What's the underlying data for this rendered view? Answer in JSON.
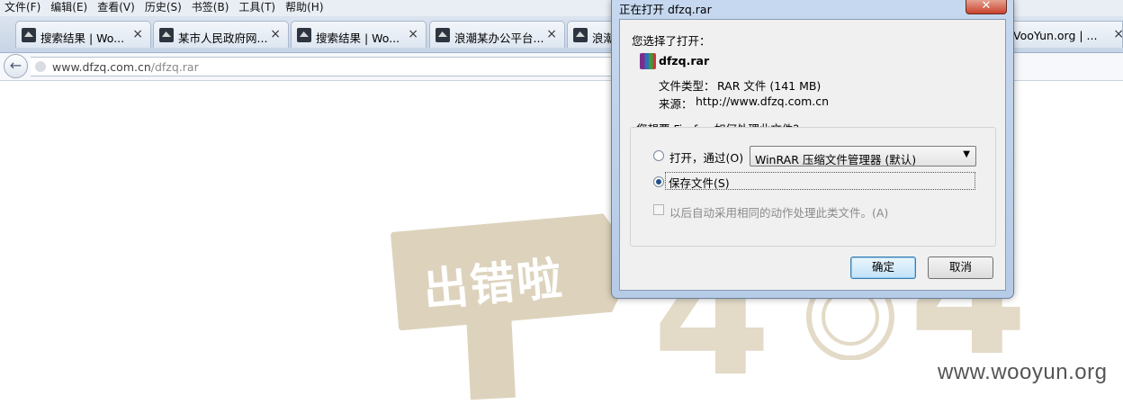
{
  "menu": [
    "文件(F)",
    "编辑(E)",
    "查看(V)",
    "历史(S)",
    "书签(B)",
    "工具(T)",
    "帮助(H)"
  ],
  "tabs": [
    {
      "label": "搜索结果 | Wo..."
    },
    {
      "label": "某市人民政府网..."
    },
    {
      "label": "搜索结果 | Wo..."
    },
    {
      "label": "浪潮某办公平台..."
    },
    {
      "label": "浪潮"
    }
  ],
  "right_tab": {
    "label": "VooYun.org | ..."
  },
  "close_glyph": "×",
  "nav": {
    "back_glyph": "←",
    "url_domain": "www.dfzq.com.cn",
    "url_path": "/dfzq.rar"
  },
  "background": {
    "sign_text": "出错啦",
    "digit_left": "4",
    "digit_right": "4",
    "watermark": "www.wooyun.org"
  },
  "dialog": {
    "title": "正在打开 dfzq.rar",
    "close_glyph": "✕",
    "intro": "您选择了打开：",
    "filename": "dfzq.rar",
    "file_type_label": "文件类型：",
    "file_type_value": "RAR 文件 (141 MB)",
    "source_label": "来源：",
    "source_value": "http://www.dfzq.com.cn",
    "question": "您想要 Firefox 如何处理此文件？",
    "open_with_label": "打开，通过(O)",
    "app_selected": "WinRAR 压缩文件管理器 (默认)",
    "dropdown_arrow": "▼",
    "save_label": "保存文件(S)",
    "save_selected": true,
    "auto_label": "以后自动采用相同的动作处理此类文件。(A)",
    "auto_checked": false,
    "ok_label": "确定",
    "cancel_label": "取消"
  }
}
